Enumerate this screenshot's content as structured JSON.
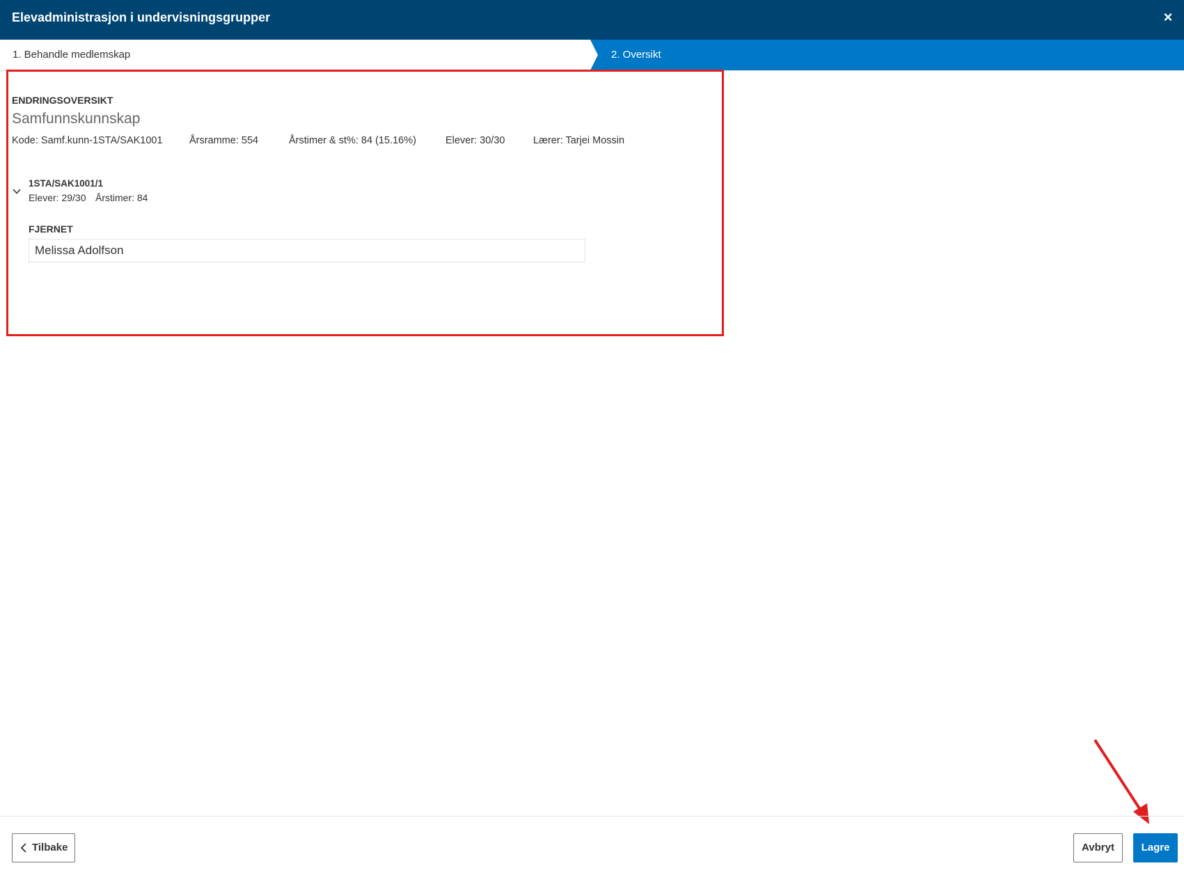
{
  "dialog": {
    "title": "Elevadministrasjon i undervisningsgrupper",
    "close_symbol": "×"
  },
  "steps": [
    {
      "label": "1. Behandle medlemskap",
      "active": false
    },
    {
      "label": "2. Oversikt",
      "active": true
    }
  ],
  "overview": {
    "section_label": "ENDRINGSOVERSIKT",
    "course_name": "Samfunnskunnskap",
    "meta": {
      "code": "Kode: Samf.kunn-1STA/SAK1001",
      "yearly_frame": "Årsramme: 554",
      "hours_pct": "Årstimer & st%: 84 (15.16%)",
      "students": "Elever: 30/30",
      "teacher": "Lærer: Tarjei Mossin"
    },
    "group": {
      "code": "1STA/SAK1001/1",
      "students": "Elever: 29/30",
      "hours": "Årstimer: 84",
      "removed_label": "FJERNET",
      "removed_students": [
        "Melissa Adolfson"
      ]
    }
  },
  "footer": {
    "back_label": "Tilbake",
    "cancel_label": "Avbryt",
    "save_label": "Lagre"
  },
  "colors": {
    "header_bg": "#004471",
    "accent": "#0078c8",
    "annotation_red": "#e01f1f"
  },
  "icons": {
    "close": "close-icon",
    "chevron": "chevron-down-icon",
    "back": "chevron-left-icon"
  }
}
